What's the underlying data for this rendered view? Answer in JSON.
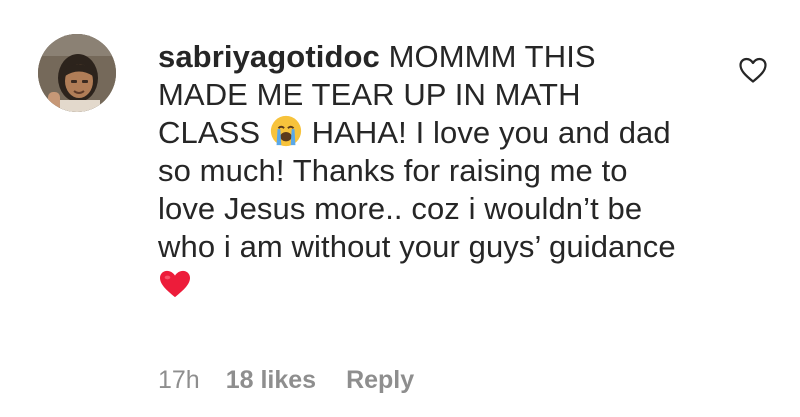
{
  "comment": {
    "username": "sabriyagotidoc",
    "text_part1": "MOMMM THIS MADE ME TEAR UP IN MATH CLASS",
    "emoji_1": "loudly-crying-face",
    "text_part2": "HAHA! I love you and dad so much! Thanks for raising me to love Jesus more.. coz i wouldn’t be who i am without your guys’ guidance",
    "emoji_2": "red-heart",
    "timestamp": "17h",
    "likes": "18 likes",
    "reply_label": "Reply",
    "like_icon": "heart-outline-icon"
  },
  "colors": {
    "text": "#262626",
    "meta": "#8e8e8e",
    "heart": "#ed1c3a"
  }
}
